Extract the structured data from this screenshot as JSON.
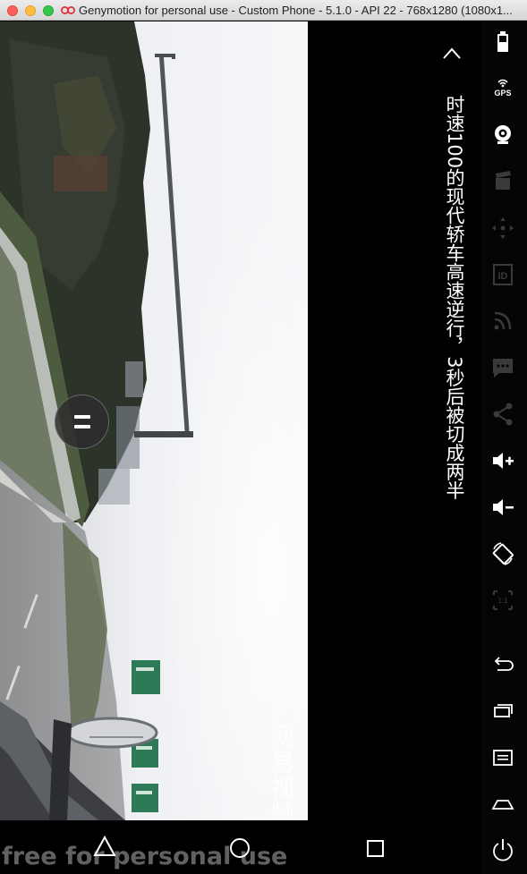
{
  "window": {
    "title": "Genymotion for personal use - Custom Phone - 5.1.0 - API 22 - 768x1280 (1080x1..."
  },
  "video": {
    "watermark": "网易视频",
    "caption": "时速100的现代轿车高速逆行，3秒后被切成两半"
  },
  "toolbar": {
    "items": [
      {
        "name": "battery",
        "icon": "battery-icon"
      },
      {
        "name": "gps",
        "icon": "gps-icon",
        "label": "GPS"
      },
      {
        "name": "webcam",
        "icon": "webcam-icon"
      },
      {
        "name": "screencast",
        "icon": "clapperboard-icon"
      },
      {
        "name": "dpad",
        "icon": "dpad-icon"
      },
      {
        "name": "identifiers",
        "icon": "id-icon",
        "label": "ID"
      },
      {
        "name": "network",
        "icon": "rss-icon"
      },
      {
        "name": "sms",
        "icon": "message-icon"
      },
      {
        "name": "share",
        "icon": "share-icon"
      },
      {
        "name": "volume-up",
        "icon": "volume-up-icon"
      },
      {
        "name": "volume-down",
        "icon": "volume-down-icon"
      },
      {
        "name": "rotate",
        "icon": "rotate-icon"
      },
      {
        "name": "pixel-perfect",
        "icon": "scale-icon",
        "label": "1:1"
      },
      {
        "name": "back",
        "icon": "back-icon"
      },
      {
        "name": "recent-apps",
        "icon": "recent-apps-icon"
      },
      {
        "name": "menu",
        "icon": "menu-icon"
      },
      {
        "name": "home",
        "icon": "home-icon"
      },
      {
        "name": "power",
        "icon": "power-icon"
      }
    ]
  },
  "navbar": {
    "items": [
      {
        "name": "back",
        "icon": "triangle-back-icon"
      },
      {
        "name": "home",
        "icon": "circle-home-icon"
      },
      {
        "name": "recents",
        "icon": "square-recents-icon"
      }
    ]
  },
  "license_watermark": "free for personal use",
  "colors": {
    "toolbar_bg": "#050505",
    "icon": "#ffffff",
    "icon_disabled": "#3a3a3a"
  }
}
